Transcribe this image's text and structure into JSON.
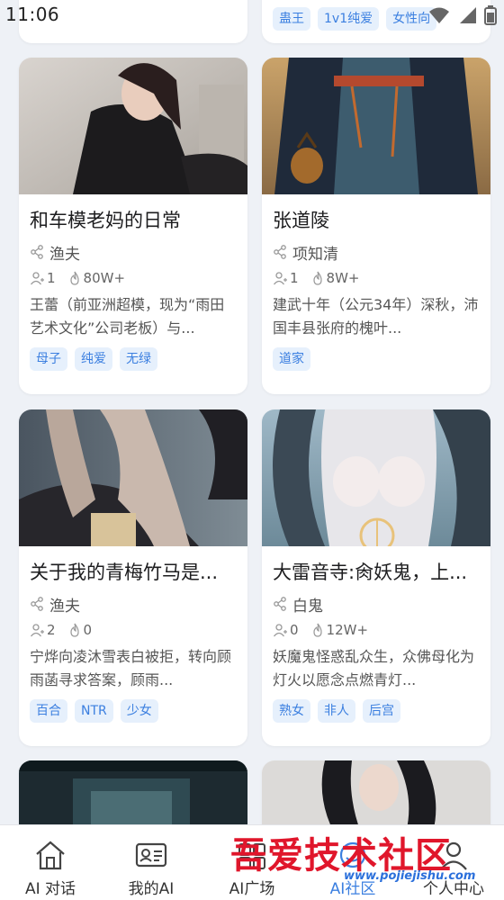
{
  "status_bar": {
    "time": "11:06"
  },
  "top_cards": {
    "right_tags": [
      "蛊王",
      "1v1纯爱",
      "女性向"
    ]
  },
  "cards": [
    {
      "title": "和车模老妈的日常",
      "author": "渔夫",
      "users": "1",
      "heat": "80W+",
      "desc": "王蕾（前亚洲超模，现为“雨田艺术文化”公司老板）与...",
      "tags": [
        "母子",
        "纯爱",
        "无绿"
      ]
    },
    {
      "title": "张道陵",
      "author": "项知清",
      "users": "1",
      "heat": "8W+",
      "desc": "建武十年（公元34年）深秋，沛国丰县张府的槐叶...",
      "tags": [
        "道家"
      ]
    },
    {
      "title": "关于我的青梅竹马是...",
      "author": "渔夫",
      "users": "2",
      "heat": "0",
      "desc": "宁烨向凌沐雪表白被拒，转向顾雨菡寻求答案，顾雨...",
      "tags": [
        "百合",
        "NTR",
        "少女"
      ]
    },
    {
      "title": "大雷音寺:肏妖鬼，上...",
      "author": "白鬼",
      "users": "0",
      "heat": "12W+",
      "desc": "妖魔鬼怪惑乱众生，众佛母化为灯火以愿念点燃青灯...",
      "tags": [
        "熟女",
        "非人",
        "后宫"
      ]
    }
  ],
  "bottom_nav": [
    {
      "label": "AI 对话",
      "icon": "home-icon"
    },
    {
      "label": "我的AI",
      "icon": "id-card-icon"
    },
    {
      "label": "AI广场",
      "icon": "plaza-icon"
    },
    {
      "label": "AI社区",
      "icon": "community-icon"
    },
    {
      "label": "个人中心",
      "icon": "user-icon"
    }
  ],
  "watermark": {
    "big": "吾爱技术社区",
    "small": "www.pojiejishu.com"
  },
  "colors": {
    "tag_text": "#3b7fe0",
    "tag_bg": "#e6f0fc",
    "background": "#eef1f6"
  }
}
